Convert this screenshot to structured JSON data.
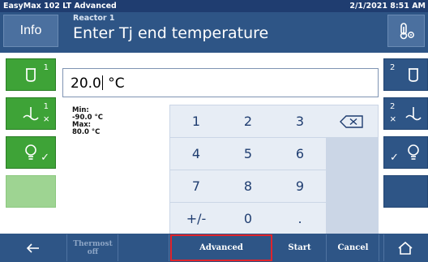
{
  "titlebar": {
    "app": "EasyMax 102 LT Advanced",
    "datetime": "2/1/2021 8:51 AM"
  },
  "header": {
    "info_label": "Info",
    "subtitle": "Reactor 1",
    "title": "Enter Tj end temperature",
    "right_icon": "thermostat-settings-icon"
  },
  "input": {
    "value": "20.0",
    "unit": "°C"
  },
  "limits": {
    "min_label": "Min:",
    "min_value": "-90.0 °C",
    "max_label": "Max:",
    "max_value": "80.0 °C"
  },
  "left_buttons": [
    {
      "icon": "reactor-icon",
      "number": "1",
      "sub": ""
    },
    {
      "icon": "stirrer-icon",
      "number": "1",
      "sub": "×"
    },
    {
      "icon": "bulb-icon",
      "number": "",
      "sub": "✓"
    },
    {
      "icon": "",
      "number": "",
      "sub": ""
    }
  ],
  "right_buttons": [
    {
      "icon": "reactor-icon",
      "number": "2",
      "sub": ""
    },
    {
      "icon": "stirrer-icon",
      "number": "2",
      "sub": "×"
    },
    {
      "icon": "bulb-icon",
      "number": "",
      "sub": "✓"
    },
    {
      "icon": "",
      "number": "",
      "sub": ""
    }
  ],
  "keypad": {
    "k1": "1",
    "k2": "2",
    "k3": "3",
    "k4": "4",
    "k5": "5",
    "k6": "6",
    "k7": "7",
    "k8": "8",
    "k9": "9",
    "kpm": "+/-",
    "k0": "0",
    "kdot": "."
  },
  "footer": {
    "back_icon": "arrow-left-icon",
    "thermost_off": "Thermost off",
    "advanced": "Advanced",
    "start": "Start",
    "cancel": "Cancel",
    "home_icon": "home-icon"
  },
  "colors": {
    "accent": "#2e5586",
    "titlebar": "#1f3d70",
    "active_green": "#3ea337",
    "highlight_red": "#e0242b"
  }
}
